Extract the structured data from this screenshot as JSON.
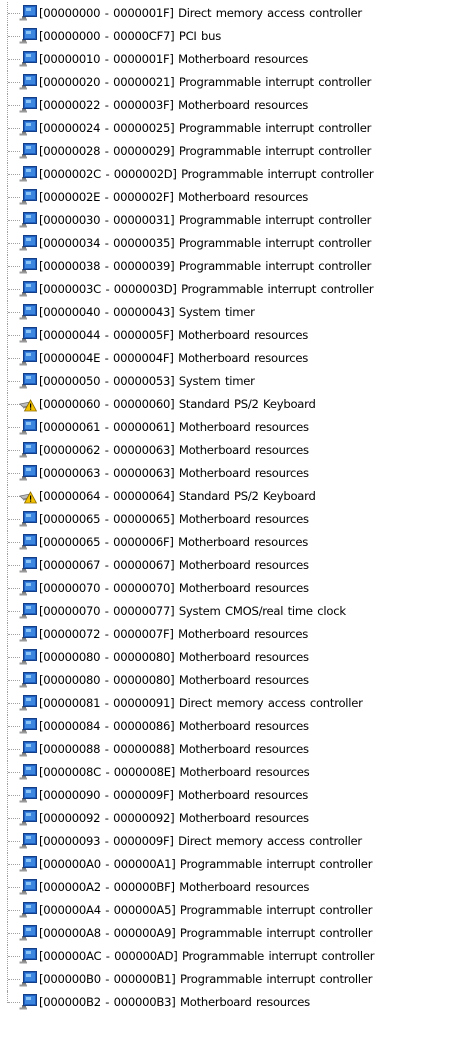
{
  "tree": {
    "rows": [
      {
        "range": "[00000000 - 0000001F]",
        "device": "Direct memory access controller",
        "icon": "device-icon"
      },
      {
        "range": "[00000000 - 00000CF7]",
        "device": "PCI bus",
        "icon": "device-icon"
      },
      {
        "range": "[00000010 - 0000001F]",
        "device": "Motherboard resources",
        "icon": "device-icon"
      },
      {
        "range": "[00000020 - 00000021]",
        "device": "Programmable interrupt controller",
        "icon": "device-icon"
      },
      {
        "range": "[00000022 - 0000003F]",
        "device": "Motherboard resources",
        "icon": "device-icon"
      },
      {
        "range": "[00000024 - 00000025]",
        "device": "Programmable interrupt controller",
        "icon": "device-icon"
      },
      {
        "range": "[00000028 - 00000029]",
        "device": "Programmable interrupt controller",
        "icon": "device-icon"
      },
      {
        "range": "[0000002C - 0000002D]",
        "device": "Programmable interrupt controller",
        "icon": "device-icon"
      },
      {
        "range": "[0000002E - 0000002F]",
        "device": "Motherboard resources",
        "icon": "device-icon"
      },
      {
        "range": "[00000030 - 00000031]",
        "device": "Programmable interrupt controller",
        "icon": "device-icon"
      },
      {
        "range": "[00000034 - 00000035]",
        "device": "Programmable interrupt controller",
        "icon": "device-icon"
      },
      {
        "range": "[00000038 - 00000039]",
        "device": "Programmable interrupt controller",
        "icon": "device-icon"
      },
      {
        "range": "[0000003C - 0000003D]",
        "device": "Programmable interrupt controller",
        "icon": "device-icon"
      },
      {
        "range": "[00000040 - 00000043]",
        "device": "System timer",
        "icon": "device-icon"
      },
      {
        "range": "[00000044 - 0000005F]",
        "device": "Motherboard resources",
        "icon": "device-icon"
      },
      {
        "range": "[0000004E - 0000004F]",
        "device": "Motherboard resources",
        "icon": "device-icon"
      },
      {
        "range": "[00000050 - 00000053]",
        "device": "System timer",
        "icon": "device-icon"
      },
      {
        "range": "[00000060 - 00000060]",
        "device": "Standard PS/2 Keyboard",
        "icon": "keyboard-warning-icon"
      },
      {
        "range": "[00000061 - 00000061]",
        "device": "Motherboard resources",
        "icon": "device-icon"
      },
      {
        "range": "[00000062 - 00000063]",
        "device": "Motherboard resources",
        "icon": "device-icon"
      },
      {
        "range": "[00000063 - 00000063]",
        "device": "Motherboard resources",
        "icon": "device-icon"
      },
      {
        "range": "[00000064 - 00000064]",
        "device": "Standard PS/2 Keyboard",
        "icon": "keyboard-warning-icon"
      },
      {
        "range": "[00000065 - 00000065]",
        "device": "Motherboard resources",
        "icon": "device-icon"
      },
      {
        "range": "[00000065 - 0000006F]",
        "device": "Motherboard resources",
        "icon": "device-icon"
      },
      {
        "range": "[00000067 - 00000067]",
        "device": "Motherboard resources",
        "icon": "device-icon"
      },
      {
        "range": "[00000070 - 00000070]",
        "device": "Motherboard resources",
        "icon": "device-icon"
      },
      {
        "range": "[00000070 - 00000077]",
        "device": "System CMOS/real time clock",
        "icon": "device-icon"
      },
      {
        "range": "[00000072 - 0000007F]",
        "device": "Motherboard resources",
        "icon": "device-icon"
      },
      {
        "range": "[00000080 - 00000080]",
        "device": "Motherboard resources",
        "icon": "device-icon"
      },
      {
        "range": "[00000080 - 00000080]",
        "device": "Motherboard resources",
        "icon": "device-icon"
      },
      {
        "range": "[00000081 - 00000091]",
        "device": "Direct memory access controller",
        "icon": "device-icon"
      },
      {
        "range": "[00000084 - 00000086]",
        "device": "Motherboard resources",
        "icon": "device-icon"
      },
      {
        "range": "[00000088 - 00000088]",
        "device": "Motherboard resources",
        "icon": "device-icon"
      },
      {
        "range": "[0000008C - 0000008E]",
        "device": "Motherboard resources",
        "icon": "device-icon"
      },
      {
        "range": "[00000090 - 0000009F]",
        "device": "Motherboard resources",
        "icon": "device-icon"
      },
      {
        "range": "[00000092 - 00000092]",
        "device": "Motherboard resources",
        "icon": "device-icon"
      },
      {
        "range": "[00000093 - 0000009F]",
        "device": "Direct memory access controller",
        "icon": "device-icon"
      },
      {
        "range": "[000000A0 - 000000A1]",
        "device": "Programmable interrupt controller",
        "icon": "device-icon"
      },
      {
        "range": "[000000A2 - 000000BF]",
        "device": "Motherboard resources",
        "icon": "device-icon"
      },
      {
        "range": "[000000A4 - 000000A5]",
        "device": "Programmable interrupt controller",
        "icon": "device-icon"
      },
      {
        "range": "[000000A8 - 000000A9]",
        "device": "Programmable interrupt controller",
        "icon": "device-icon"
      },
      {
        "range": "[000000AC - 000000AD]",
        "device": "Programmable interrupt controller",
        "icon": "device-icon"
      },
      {
        "range": "[000000B0 - 000000B1]",
        "device": "Programmable interrupt controller",
        "icon": "device-icon"
      },
      {
        "range": "[000000B2 - 000000B3]",
        "device": "Motherboard resources",
        "icon": "device-icon"
      }
    ]
  },
  "colors": {
    "guide": "#a0a0a0",
    "device_body": "#2a6fd4",
    "device_accent": "#6fb0f0",
    "warning_yellow": "#f2c200"
  }
}
